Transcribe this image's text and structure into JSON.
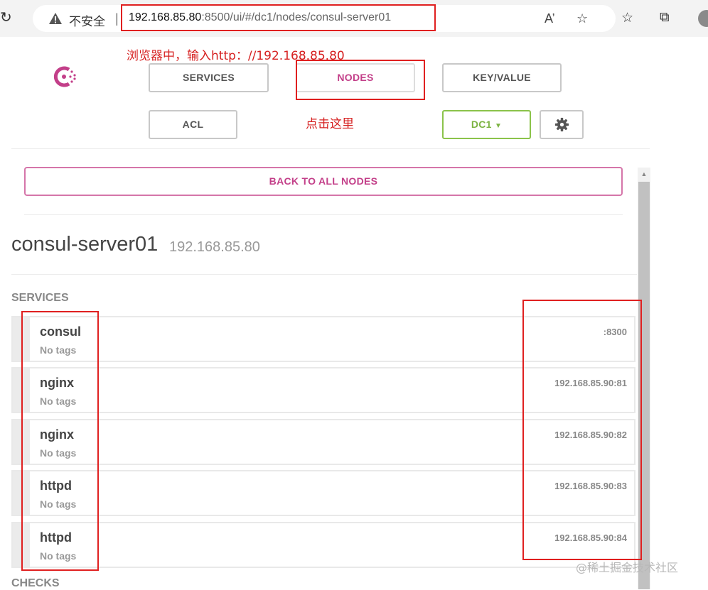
{
  "browser": {
    "security_label": "不安全",
    "separator": "|",
    "url_host": "192.168.85.80",
    "url_rest": ":8500/ui/#/dc1/nodes/consul-server01"
  },
  "nav": {
    "services": "SERVICES",
    "nodes": "NODES",
    "key_value": "KEY/VALUE",
    "acl": "ACL",
    "datacenter": "DC1"
  },
  "back_button": "BACK TO ALL NODES",
  "node": {
    "name": "consul-server01",
    "ip": "192.168.85.80"
  },
  "sections": {
    "services": "SERVICES",
    "checks": "CHECKS"
  },
  "services": [
    {
      "name": "consul",
      "tags": "No tags",
      "address": ":8300"
    },
    {
      "name": "nginx",
      "tags": "No tags",
      "address": "192.168.85.90:81"
    },
    {
      "name": "nginx",
      "tags": "No tags",
      "address": "192.168.85.90:82"
    },
    {
      "name": "httpd",
      "tags": "No tags",
      "address": "192.168.85.90:83"
    },
    {
      "name": "httpd",
      "tags": "No tags",
      "address": "192.168.85.90:84"
    }
  ],
  "annotations": {
    "browser_hint": "浏览器中，输入http：//192.168.85.80",
    "click_hint": "点击这里"
  },
  "watermark": "@稀土掘金技术社区",
  "colors": {
    "brand": "#c33f89",
    "dc": "#7cb342",
    "annotation": "#e02020"
  }
}
